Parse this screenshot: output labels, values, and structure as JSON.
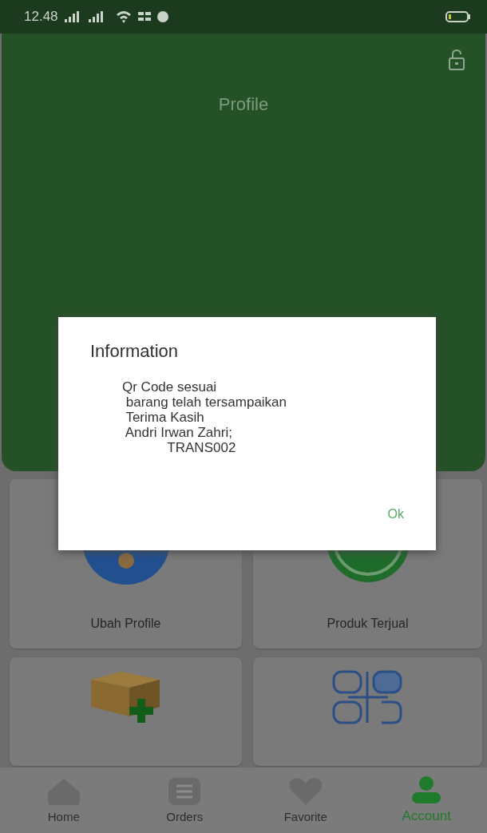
{
  "status_bar": {
    "time": "12.48"
  },
  "header": {
    "title": "Profile"
  },
  "menu": [
    {
      "kind": "labeled",
      "label": "Ubah Profile"
    },
    {
      "kind": "labeled",
      "label": "Produk Terjual"
    },
    {
      "kind": "plain"
    },
    {
      "kind": "plain"
    }
  ],
  "dialog": {
    "title": "Information",
    "message": "Qr Code sesuai\n barang telah tersampaikan\n Terima Kasih\n Andri Irwan Zahri;\n            TRANS002",
    "button": "Ok"
  },
  "nav": [
    {
      "label": "Home",
      "selected": false
    },
    {
      "label": "Orders",
      "selected": false
    },
    {
      "label": "Favorite",
      "selected": false
    },
    {
      "label": "Account",
      "selected": true
    }
  ]
}
